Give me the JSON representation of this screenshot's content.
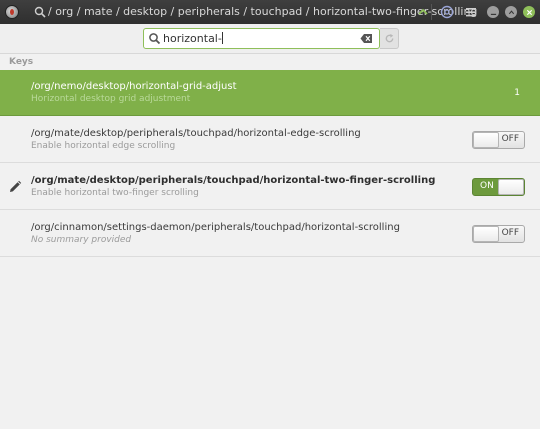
{
  "titlebar": {
    "path": "/ org / mate / desktop / peripherals / touchpad / horizontal-two-finger-scrolling"
  },
  "search": {
    "value": "horizontal-"
  },
  "section": {
    "header": "Keys"
  },
  "rows": [
    {
      "path": "/org/nemo/desktop/horizontal-grid-adjust",
      "summary": "Horizontal desktop grid adjustment",
      "value": "1"
    },
    {
      "path": "/org/mate/desktop/peripherals/touchpad/horizontal-edge-scrolling",
      "summary": "Enable horizontal edge scrolling",
      "toggle": "OFF"
    },
    {
      "path": "/org/mate/desktop/peripherals/touchpad/horizontal-two-finger-scrolling",
      "summary": "Enable horizontal two-finger scrolling",
      "toggle": "ON"
    },
    {
      "path": "/org/cinnamon/settings-daemon/peripherals/touchpad/horizontal-scrolling",
      "summary": "No summary provided",
      "toggle": "OFF"
    }
  ],
  "colors": {
    "accent": "#80b049",
    "titlebar": "#353535"
  },
  "icons": {
    "app": "dconf-editor-icon",
    "search": "search-icon",
    "clear": "clear-input-icon",
    "refresh": "refresh-icon",
    "back": "back-icon",
    "help": "help-icon",
    "menu": "hamburger-menu-icon",
    "edit": "pencil-icon"
  }
}
